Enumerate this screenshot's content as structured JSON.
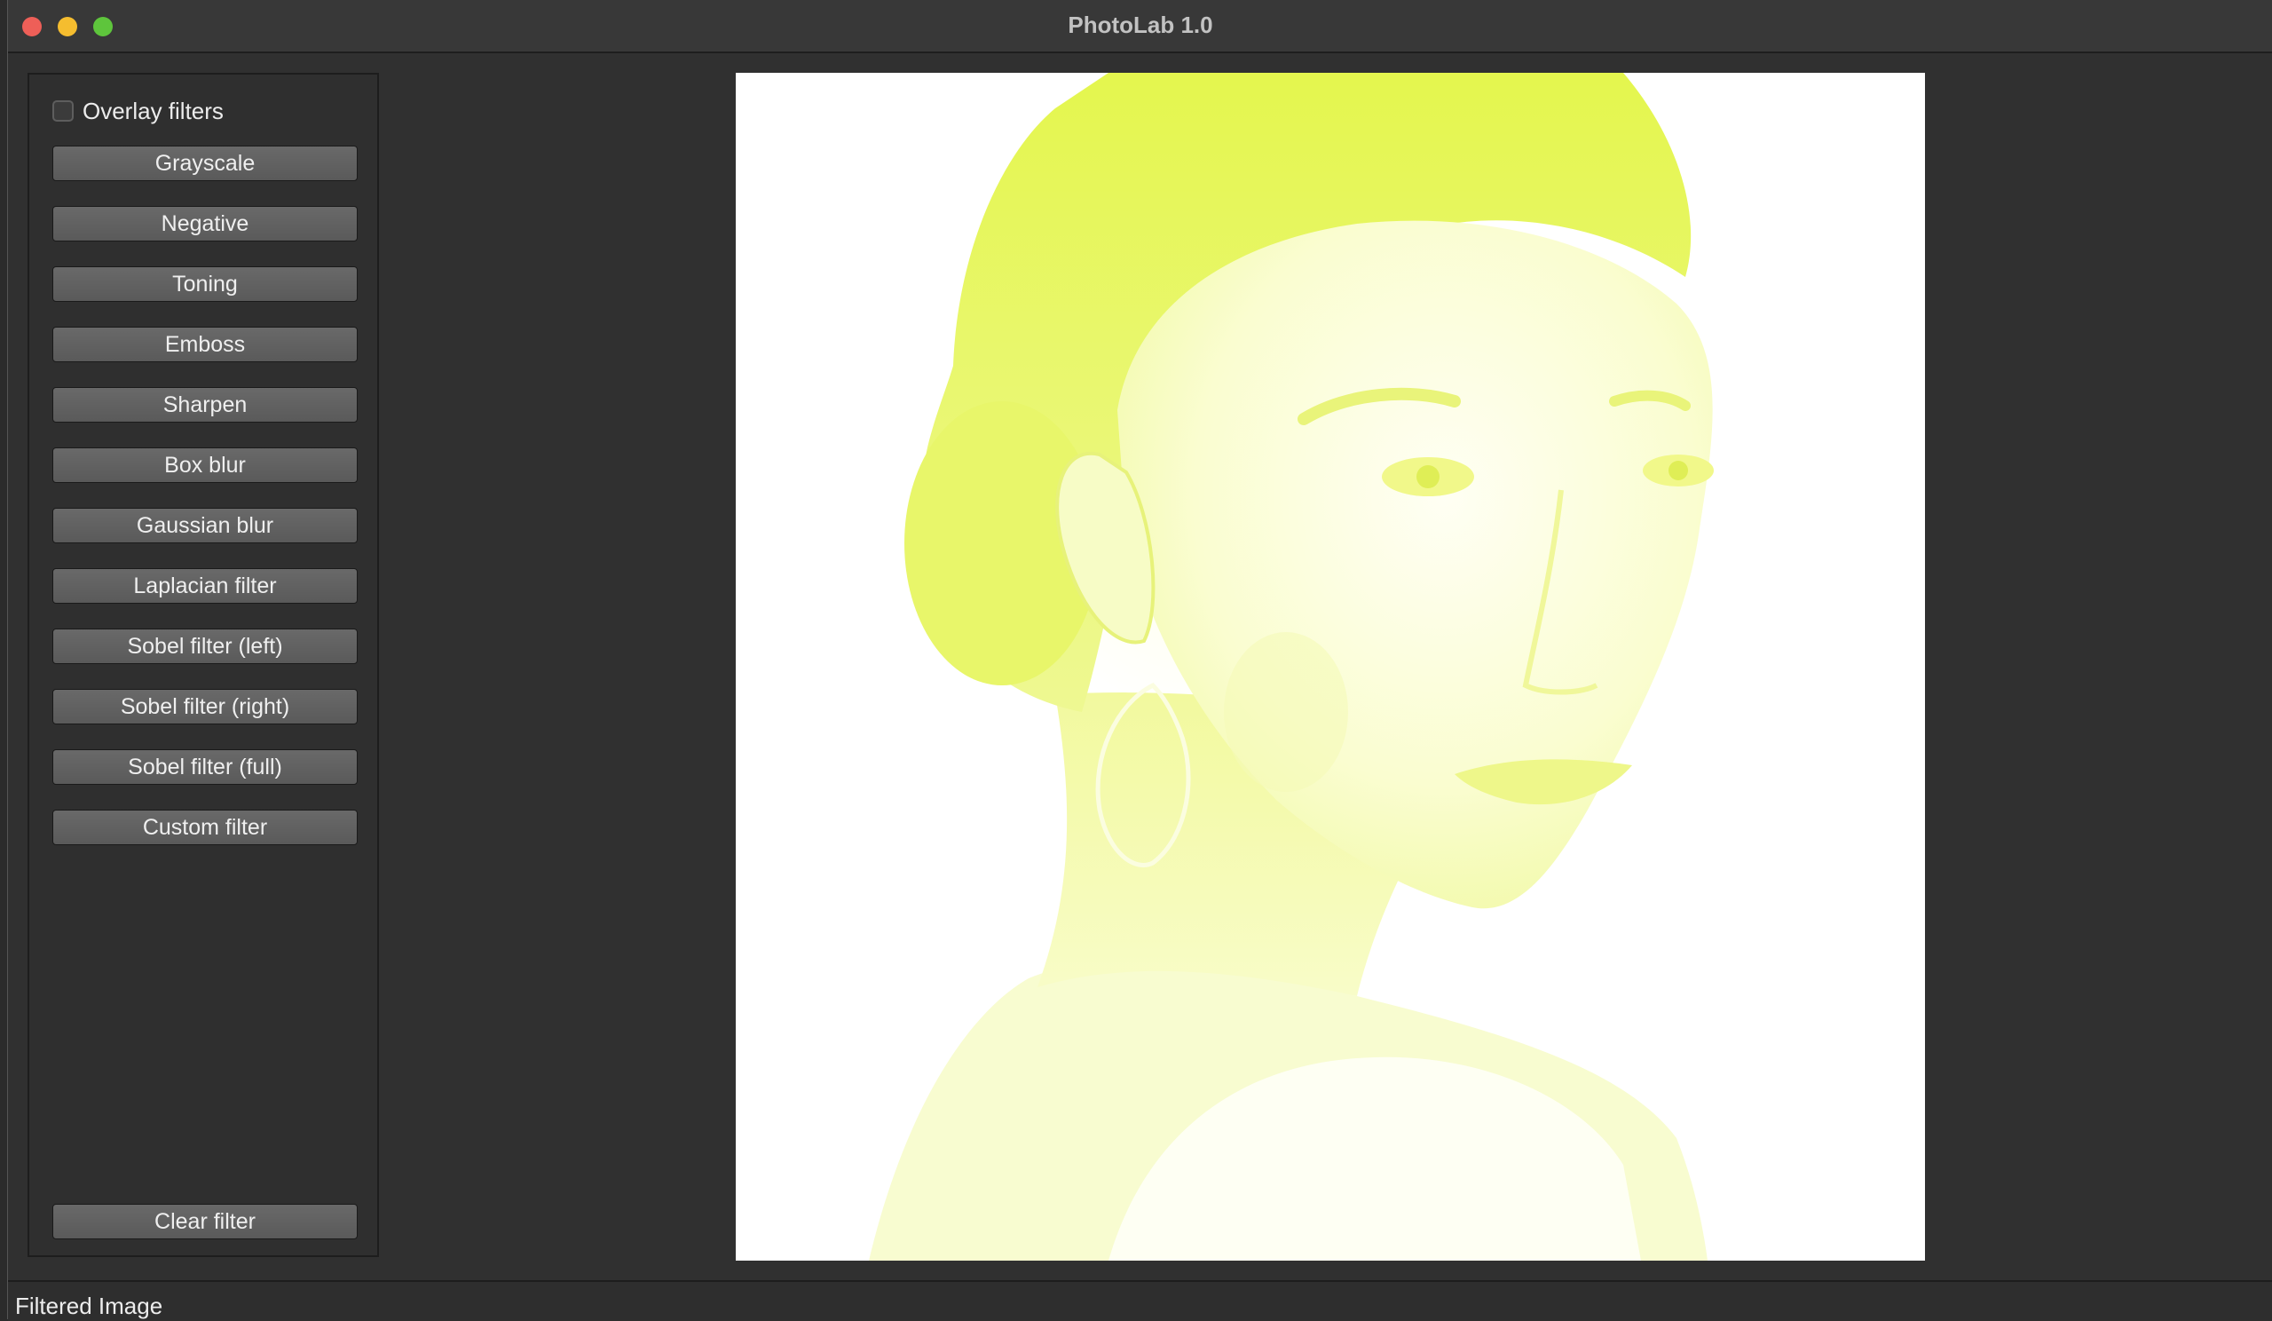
{
  "window": {
    "title": "PhotoLab 1.0"
  },
  "sidebar": {
    "overlay_label": "Overlay filters",
    "overlay_checked": false,
    "filters": [
      "Grayscale",
      "Negative",
      "Toning",
      "Emboss",
      "Sharpen",
      "Box blur",
      "Gaussian blur",
      "Laplacian filter",
      "Sobel filter (left)",
      "Sobel filter (right)",
      "Sobel filter (full)",
      "Custom filter"
    ],
    "clear_label": "Clear filter"
  },
  "status": {
    "text": "Filtered Image"
  },
  "colors": {
    "image_tint": "#e6f55a",
    "background": "#303030"
  }
}
